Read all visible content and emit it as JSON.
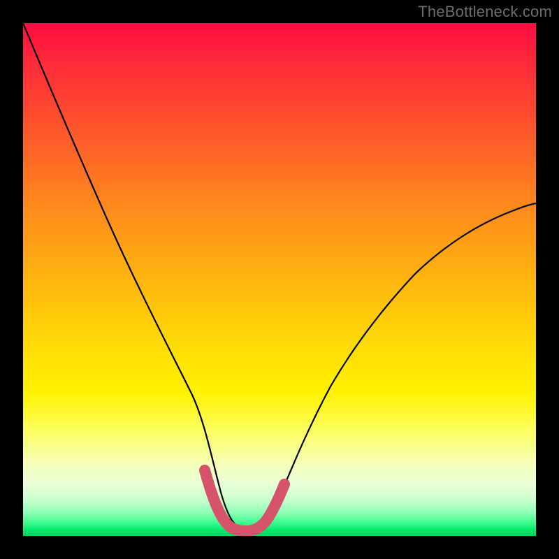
{
  "watermark": "TheBottleneck.com",
  "colors": {
    "frame": "#000000",
    "watermark": "#6d6d6d",
    "curve": "#000000",
    "highlight": "#d6536c"
  },
  "chart_data": {
    "type": "line",
    "title": "",
    "xlabel": "",
    "ylabel": "",
    "xlim": [
      0,
      100
    ],
    "ylim": [
      0,
      100
    ],
    "grid": false,
    "series": [
      {
        "name": "bottleneck-curve",
        "x": [
          0,
          5,
          10,
          15,
          20,
          25,
          30,
          34,
          36,
          38,
          41,
          44,
          47,
          49,
          51,
          55,
          60,
          65,
          70,
          75,
          80,
          85,
          90,
          95,
          100
        ],
        "y": [
          100,
          87,
          74,
          62,
          50,
          39,
          28,
          18,
          13,
          8,
          3,
          1,
          1,
          2,
          6,
          13,
          22,
          29,
          35,
          41,
          46,
          51,
          55,
          59,
          63
        ]
      }
    ],
    "highlight": {
      "name": "bottom-segment",
      "x": [
        36,
        38,
        41,
        44,
        47,
        49,
        51
      ],
      "y": [
        13,
        8,
        3,
        1,
        1,
        2,
        6
      ]
    },
    "gradient_stops": [
      {
        "pos": 0,
        "color": "#ff0b42"
      },
      {
        "pos": 36,
        "color": "#ff8a1c"
      },
      {
        "pos": 62,
        "color": "#ffd907"
      },
      {
        "pos": 80,
        "color": "#fdff67"
      },
      {
        "pos": 95.5,
        "color": "#8bffb3"
      },
      {
        "pos": 100,
        "color": "#00d95f"
      }
    ]
  }
}
